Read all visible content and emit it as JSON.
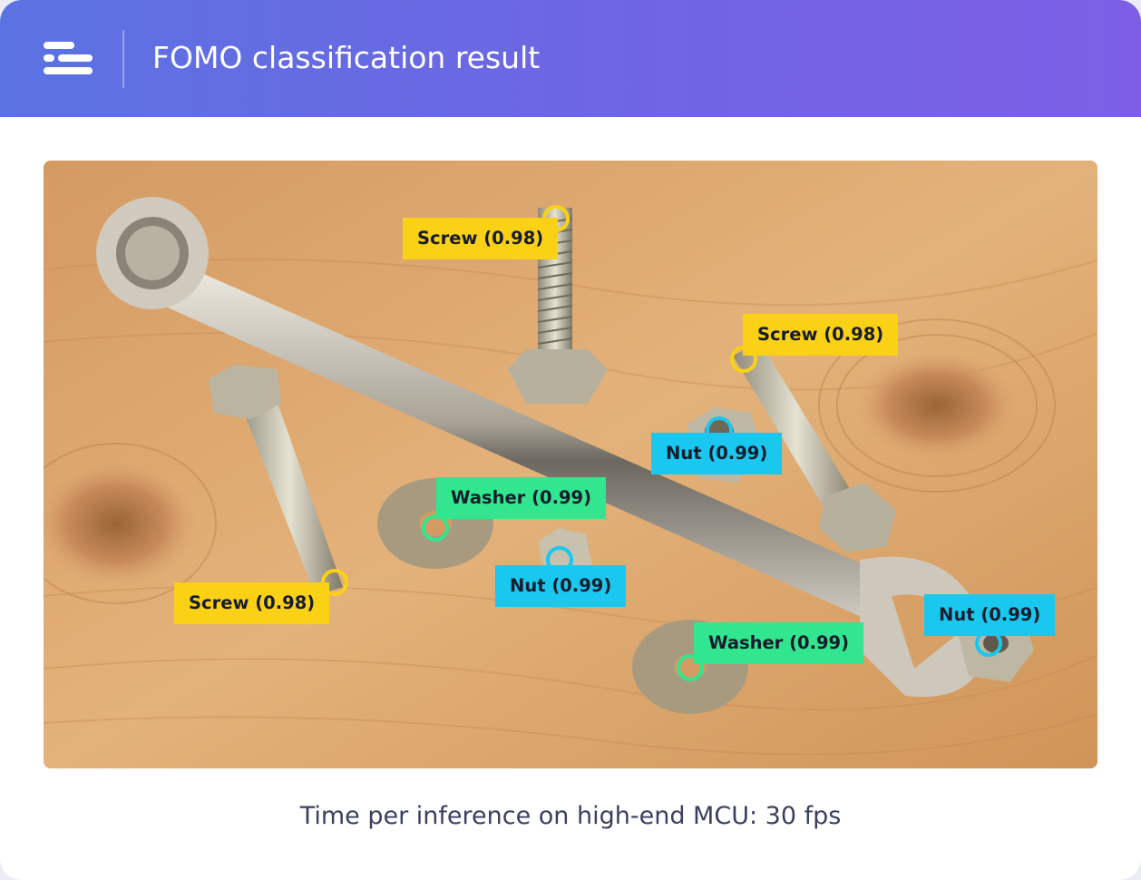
{
  "header": {
    "title": "FOMO classification result",
    "menu_icon": "menu-lines-icon"
  },
  "detections": [
    {
      "label": "Screw (0.98)",
      "class": "screw"
    },
    {
      "label": "Screw (0.98)",
      "class": "screw"
    },
    {
      "label": "Screw (0.98)",
      "class": "screw"
    },
    {
      "label": "Nut (0.99)",
      "class": "nut"
    },
    {
      "label": "Nut (0.99)",
      "class": "nut"
    },
    {
      "label": "Nut (0.99)",
      "class": "nut"
    },
    {
      "label": "Washer (0.99)",
      "class": "washer"
    },
    {
      "label": "Washer (0.99)",
      "class": "washer"
    }
  ],
  "footer": {
    "text": "Time per inference on high-end MCU: 30 fps"
  },
  "colors": {
    "screw": "#fbd115",
    "nut": "#19c7ef",
    "washer": "#32e58f",
    "header_start": "#5b73e2",
    "header_end": "#7d5fe6"
  }
}
